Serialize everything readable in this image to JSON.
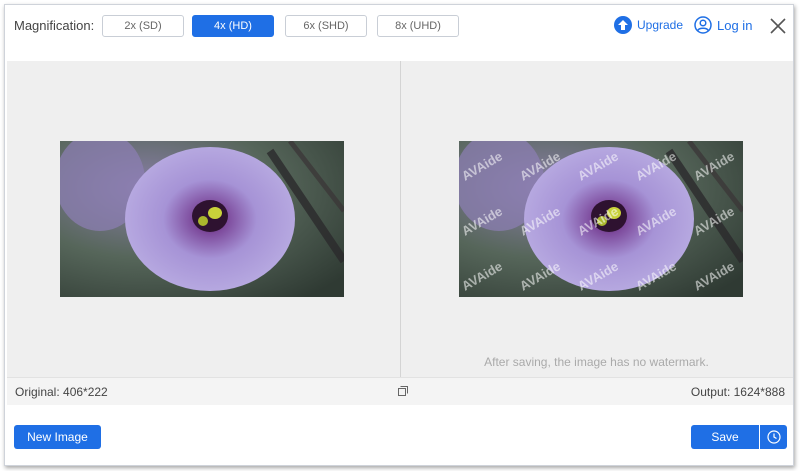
{
  "header": {
    "magnification_label": "Magnification:",
    "options": [
      {
        "label": "2x (SD)",
        "active": false
      },
      {
        "label": "4x (HD)",
        "active": true
      },
      {
        "label": "6x (SHD)",
        "active": false
      },
      {
        "label": "8x (UHD)",
        "active": false
      }
    ],
    "upgrade_label": "Upgrade",
    "login_label": "Log in"
  },
  "preview": {
    "watermark_text": "AVAide",
    "note": "After saving, the image has no watermark."
  },
  "info": {
    "original": "Original: 406*222",
    "output": "Output: 1624*888"
  },
  "footer": {
    "new_image_label": "New Image",
    "save_label": "Save"
  },
  "colors": {
    "accent": "#1f6fe5",
    "preview_bg": "#efefef"
  },
  "icons": [
    "upgrade-icon",
    "user-icon",
    "close-icon",
    "compare-icon",
    "clock-icon"
  ]
}
